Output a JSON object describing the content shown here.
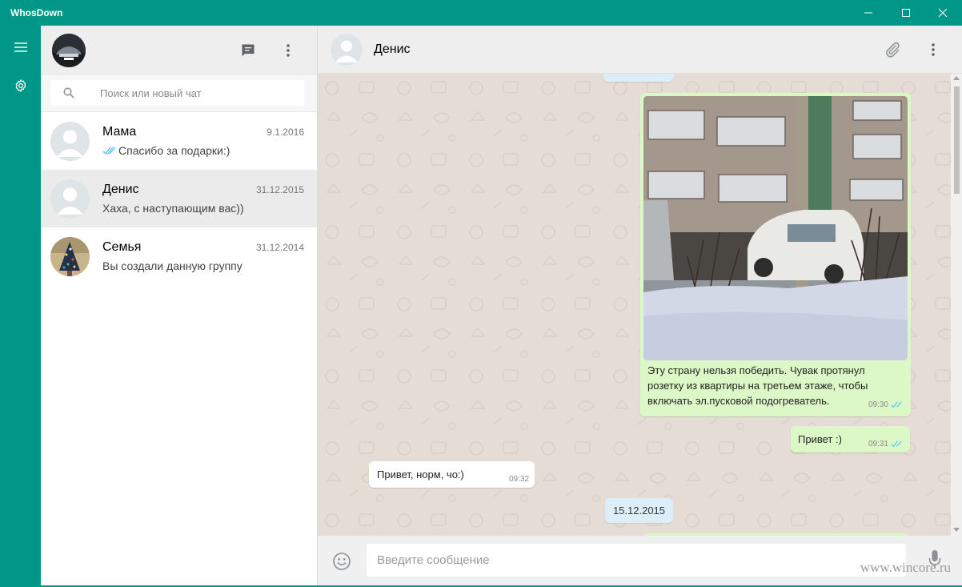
{
  "window": {
    "title": "WhosDown",
    "minimize_icon": "minimize-icon",
    "maximize_icon": "maximize-icon",
    "close_icon": "close-icon"
  },
  "rail": {
    "menu_icon": "hamburger-menu-icon",
    "settings_icon": "gear-icon"
  },
  "list_header": {
    "new_chat_icon": "chat-bubble-icon",
    "more_icon": "more-vertical-icon"
  },
  "search": {
    "placeholder": "Поиск или новый чат",
    "icon": "search-icon"
  },
  "chats": [
    {
      "name": "Мама",
      "date": "9.1.2016",
      "last_message": "Спасибо за подарки:)",
      "read_ticks": true,
      "active": false
    },
    {
      "name": "Денис",
      "date": "31.12.2015",
      "last_message": "Хаха, с наступающим вас))",
      "read_ticks": false,
      "active": true
    },
    {
      "name": "Семья",
      "date": "31.12.2014",
      "last_message": "Вы создали данную группу",
      "read_ticks": false,
      "active": false
    }
  ],
  "conversation": {
    "contact_name": "Денис",
    "attach_icon": "paperclip-icon",
    "more_icon": "more-vertical-icon",
    "messages": [
      {
        "direction": "out",
        "has_image": true,
        "text": "Эту страну нельзя победить. Чувак протянул розетку из квартиры на третьем этаже, чтобы включать эл.пусковой подогреватель.",
        "time": "09:30",
        "read": true
      },
      {
        "direction": "out",
        "has_image": false,
        "text": "Привет :)",
        "time": "09:31",
        "read": true
      },
      {
        "direction": "in",
        "has_image": false,
        "text": "Привет, норм, чо:)",
        "time": "09:32",
        "read": false
      }
    ],
    "date_chip": "15.12.2015"
  },
  "composer": {
    "placeholder": "Введите сообщение",
    "emoji_icon": "emoji-smile-icon",
    "mic_icon": "microphone-icon"
  },
  "watermark": "www.wincore.ru",
  "colors": {
    "accent": "#009688",
    "outgoing_bubble": "#dcf8c6",
    "incoming_bubble": "#ffffff",
    "chat_background": "#e5ddd5",
    "read_tick": "#4fc3f7"
  }
}
